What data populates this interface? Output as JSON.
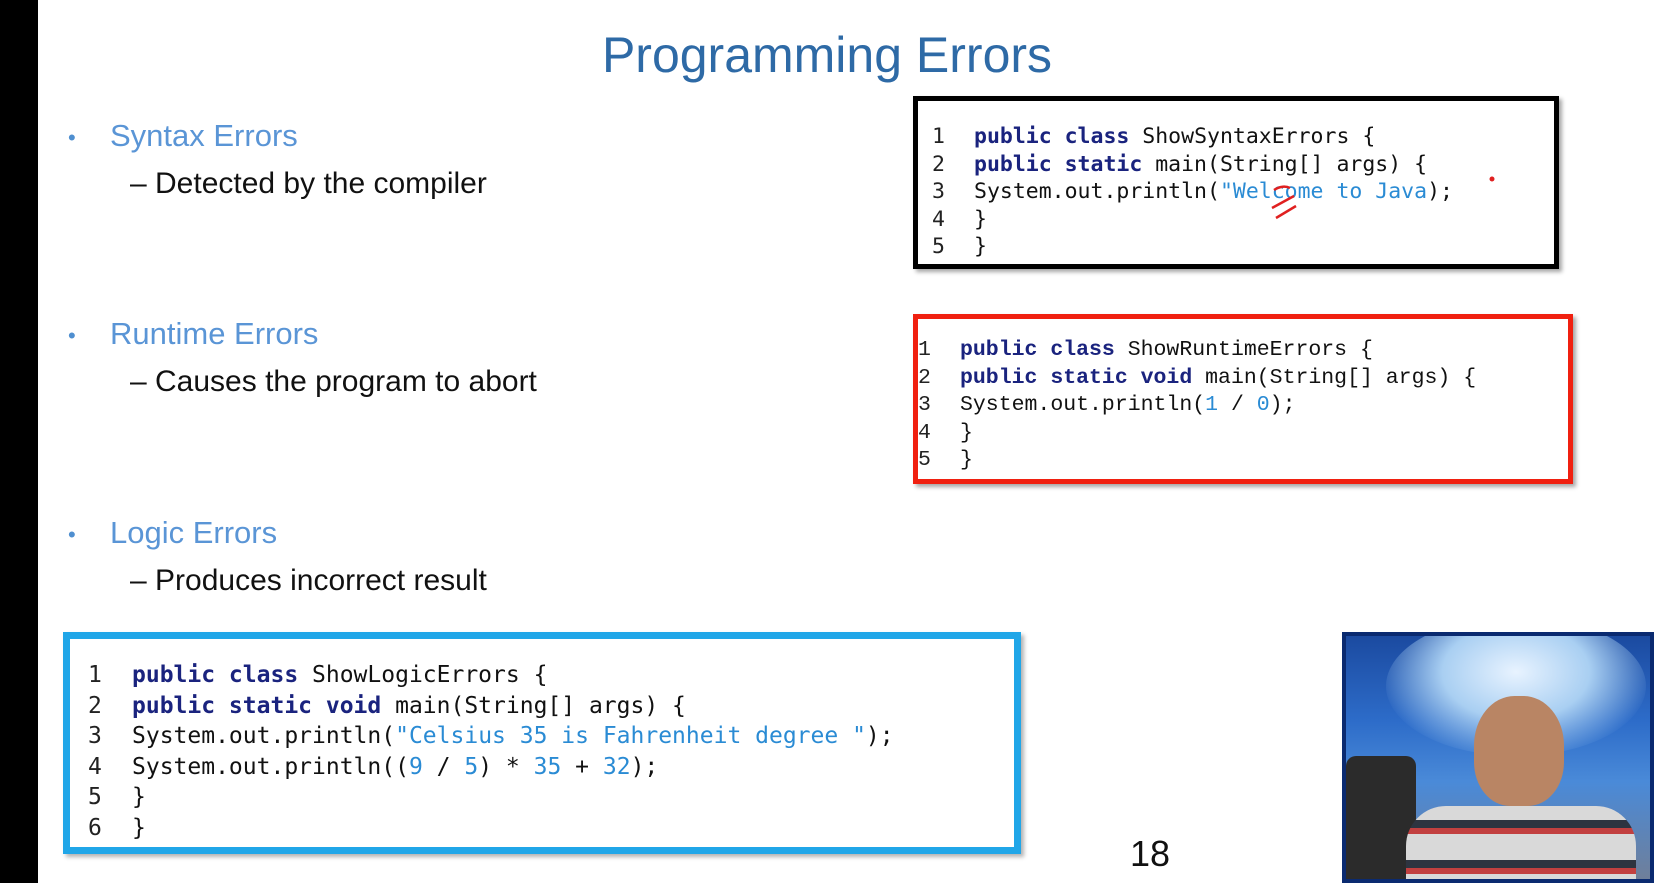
{
  "slide": {
    "title": "Programming Errors",
    "page_number": "18"
  },
  "bullets": [
    {
      "marker": "•",
      "label": "Syntax Errors",
      "sub": "– Detected by the compiler"
    },
    {
      "marker": "•",
      "label": "Runtime Errors",
      "sub": "– Causes the program to abort"
    },
    {
      "marker": "•",
      "label": "Logic Errors",
      "sub": "– Produces incorrect result"
    }
  ],
  "code_syntax": {
    "border_color": "#000000",
    "lines": [
      {
        "n": "1",
        "text": "public class ShowSyntaxErrors {"
      },
      {
        "n": "2",
        "text": "public static main(String[] args) {"
      },
      {
        "n": "3",
        "text": "System.out.println(\"Welcome to Java);"
      },
      {
        "n": "4",
        "text": "}"
      },
      {
        "n": "5",
        "text": "}"
      }
    ]
  },
  "code_runtime": {
    "border_color": "#f02010",
    "lines": [
      {
        "n": "1",
        "text": "public class ShowRuntimeErrors {"
      },
      {
        "n": "2",
        "text": "public static void main(String[] args) {"
      },
      {
        "n": "3",
        "text": "System.out.println(1 / 0);"
      },
      {
        "n": "4",
        "text": "}"
      },
      {
        "n": "5",
        "text": "}"
      }
    ]
  },
  "code_logic": {
    "border_color": "#20a6e8",
    "lines": [
      {
        "n": "1",
        "text": "public class ShowLogicErrors {"
      },
      {
        "n": "2",
        "text": "public static void main(String[] args) {"
      },
      {
        "n": "3",
        "text": "System.out.println(\"Celsius 35 is Fahrenheit degree \");"
      },
      {
        "n": "4",
        "text": "System.out.println((9 / 5) * 35 + 32);"
      },
      {
        "n": "5",
        "text": "}"
      },
      {
        "n": "6",
        "text": "}"
      }
    ]
  },
  "colors": {
    "title": "#2e6aa6",
    "bullet_label": "#5a95d6",
    "keyword": "#1a237e",
    "literal": "#2a8bd4"
  }
}
